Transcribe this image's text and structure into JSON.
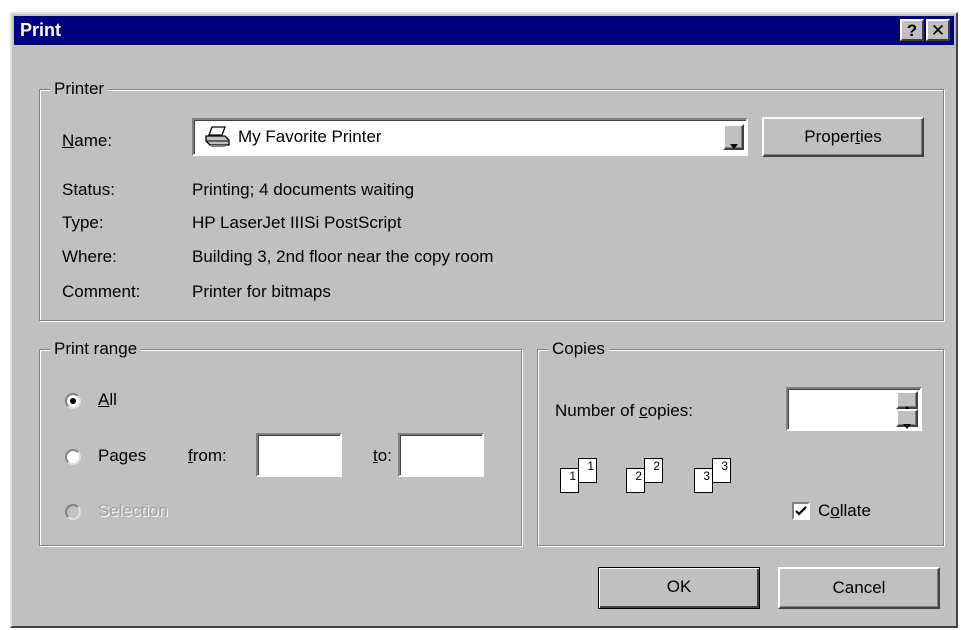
{
  "window": {
    "title": "Print",
    "help_glyph": "?",
    "close_glyph": "✕"
  },
  "printer": {
    "group_label": "Printer",
    "name_label_key": "N",
    "name_label_rest": "ame:",
    "selected_printer": "My Favorite Printer",
    "properties_pre": "Proper",
    "properties_key": "t",
    "properties_post": "ies",
    "status_label": "Status:",
    "status_value": "Printing; 4 documents waiting",
    "type_label": "Type:",
    "type_value": "HP LaserJet IIISi PostScript",
    "where_label": "Where:",
    "where_value": "Building 3, 2nd floor near the copy room",
    "comment_label": "Comment:",
    "comment_value": "Printer for bitmaps"
  },
  "print_range": {
    "group_label": "Print range",
    "all_key": "A",
    "all_rest": "ll",
    "pages_pre": "Pa",
    "pages_key": "g",
    "pages_post": "es",
    "from_key": "f",
    "from_rest": "rom:",
    "from_value": "",
    "to_key": "t",
    "to_rest": "o:",
    "to_value": "",
    "selection_label": "Selection",
    "selected_option": "all"
  },
  "copies": {
    "group_label": "Copies",
    "number_pre": "Number of ",
    "number_key": "c",
    "number_post": "opies:",
    "number_value": "",
    "collate_pre": "C",
    "collate_key": "o",
    "collate_post": "llate",
    "collate_checked": true,
    "page_numbers": [
      "1",
      "1",
      "2",
      "2",
      "3",
      "3"
    ]
  },
  "buttons": {
    "ok": "OK",
    "cancel": "Cancel"
  },
  "icons": {
    "printer": "printer-icon",
    "dropdown": "dropdown-arrow-icon",
    "spin_up": "spin-up-icon",
    "spin_down": "spin-down-icon",
    "check": "checkmark-icon"
  },
  "colors": {
    "titlebar": "#000080",
    "face": "#c0c0c0"
  }
}
